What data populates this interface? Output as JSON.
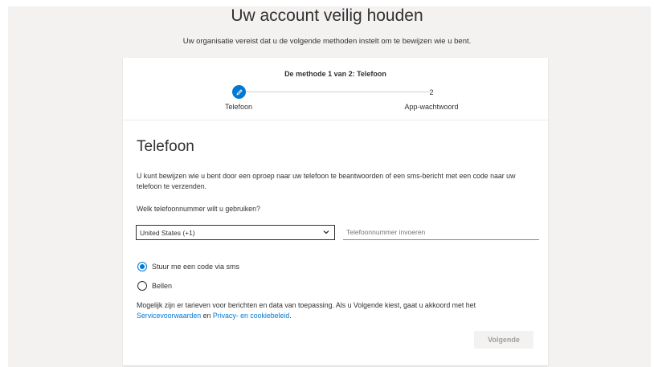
{
  "header": {
    "title": "Uw account veilig houden",
    "subtitle": "Uw organisatie vereist dat u de volgende methoden instelt om te bewijzen wie u bent."
  },
  "wizard": {
    "step_header": "De methode 1 van 2: Telefoon",
    "steps": [
      {
        "label": "Telefoon",
        "state": "active",
        "icon": "pencil-icon"
      },
      {
        "number": "2",
        "label": "App-wachtwoord",
        "state": "pending"
      }
    ],
    "accent_color": "#0078d4"
  },
  "phone_section": {
    "title": "Telefoon",
    "description": "U kunt bewijzen wie u bent door een oproep naar uw telefoon te beantwoorden of een sms-bericht met een code naar uw telefoon te verzenden.",
    "question": "Welk telefoonnummer wilt u gebruiken?",
    "country_select": {
      "value": "United States (+1)"
    },
    "phone_input": {
      "placeholder": "Telefoonnummer invoeren",
      "value": ""
    },
    "options": [
      {
        "label": "Stuur me een code via sms",
        "checked": true
      },
      {
        "label": "Bellen",
        "checked": false
      }
    ],
    "terms": {
      "text_before": "Mogelijk zijn er tarieven voor berichten en data van toepassing. Als u Volgende kiest, gaat u akkoord met het ",
      "service_link": "Servicevoorwaarden",
      "text_middle": " en ",
      "privacy_link": "Privacy- en cookiebeleid",
      "text_after": "."
    },
    "next_label": "Volgende"
  }
}
